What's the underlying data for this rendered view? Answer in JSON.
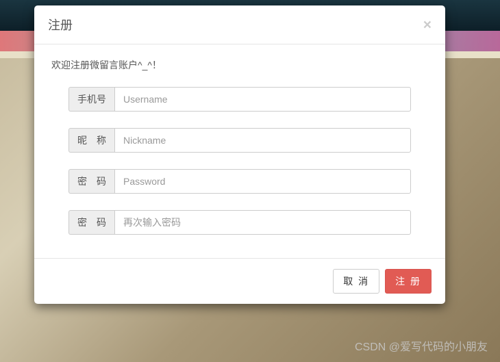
{
  "modal": {
    "title": "注册",
    "close_symbol": "×",
    "welcome": "欢迎注册微留言账户^_^！",
    "fields": {
      "phone": {
        "label": "手机号",
        "placeholder": "Username",
        "value": ""
      },
      "nickname": {
        "label": "昵　称",
        "placeholder": "Nickname",
        "value": ""
      },
      "password": {
        "label": "密　码",
        "placeholder": "Password",
        "value": ""
      },
      "password2": {
        "label": "密　码",
        "placeholder": "再次输入密码",
        "value": ""
      }
    },
    "buttons": {
      "cancel": "取 消",
      "submit": "注 册"
    }
  },
  "watermark": "CSDN @爱写代码的小朋友"
}
